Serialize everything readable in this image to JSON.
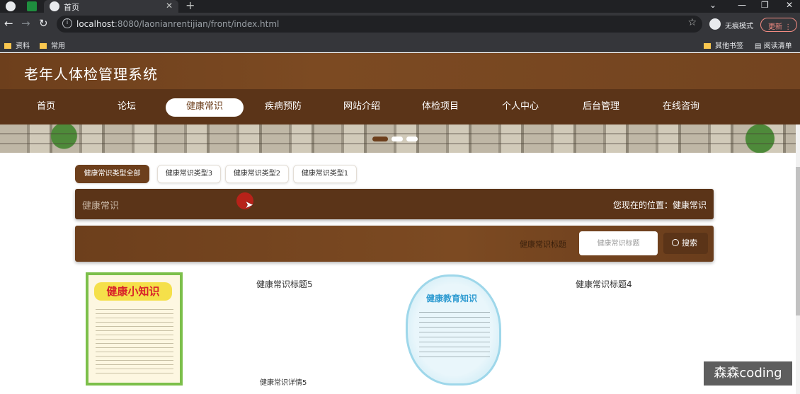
{
  "browser": {
    "tab_title": "首页",
    "url_host": "localhost",
    "url_rest": ":8080/laonianrentijian/front/index.html",
    "incognito_label": "无痕模式",
    "update_label": "更新",
    "bookmarks": [
      "资料",
      "常用"
    ],
    "bookmarks_right": [
      "其他书签",
      "阅读清单"
    ]
  },
  "site": {
    "title": "老年人体检管理系统",
    "nav": [
      "首页",
      "论坛",
      "健康常识",
      "疾病预防",
      "网站介绍",
      "体检项目",
      "个人中心",
      "后台管理",
      "在线咨询"
    ],
    "active_nav": "健康常识"
  },
  "filters": [
    "健康常识类型全部",
    "健康常识类型3",
    "健康常识类型2",
    "健康常识类型1"
  ],
  "position_bar": {
    "section": "健康常识",
    "location": "您现在的位置：健康常识"
  },
  "search": {
    "label": "健康常识标题",
    "placeholder": "健康常识标题",
    "button": "搜索"
  },
  "cards": [
    {
      "title": "健康常识标题5",
      "detail": "健康常识详情5",
      "poster_text": "健康小知识"
    },
    {
      "title": "健康常识标题4",
      "detail": "",
      "poster_text": "健康教育知识"
    }
  ],
  "watermark": "森森coding",
  "colors": {
    "brand_brown": "#6d3f1c",
    "nav_brown": "#5b3418",
    "active_pill": "#ffffff"
  }
}
